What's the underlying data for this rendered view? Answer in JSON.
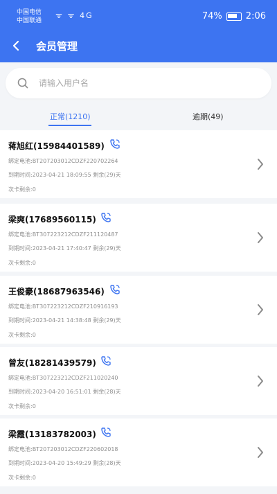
{
  "status_bar": {
    "carrier_top": "中国电信",
    "carrier_bottom": "中国联通",
    "network_icons": "ᯤ ᯤ 4G",
    "battery_percent": "74%",
    "time": "2:06"
  },
  "header": {
    "title": "会员管理"
  },
  "search": {
    "placeholder": "请输入用户名",
    "value": ""
  },
  "tabs": [
    {
      "label": "正常(1210)",
      "active": true
    },
    {
      "label": "逾期(49)",
      "active": false
    }
  ],
  "members": [
    {
      "name_phone": "蒋旭红(15984401589)",
      "battery": "绑定电池:BT207203012CDZF220702264",
      "due": "到期时间:2023-04-21 18:09:55",
      "remaining": "剩余(29)天",
      "times": "次卡剩余:0"
    },
    {
      "name_phone": "梁爽(17689560115)",
      "battery": "绑定电池:BT307223212CDZF211120487",
      "due": "到期时间:2023-04-21 17:40:47",
      "remaining": "剩余(29)天",
      "times": "次卡剩余:0"
    },
    {
      "name_phone": "王俊豪(18687963546)",
      "battery": "绑定电池:BT307223212CDZF210916193",
      "due": "到期时间:2023-04-21 14:38:48",
      "remaining": "剩余(29)天",
      "times": "次卡剩余:0"
    },
    {
      "name_phone": "曾友(18281439579)",
      "battery": "绑定电池:BT307223212CDZF211020240",
      "due": "到期时间:2023-04-20 16:51:01",
      "remaining": "剩余(28)天",
      "times": "次卡剩余:0"
    },
    {
      "name_phone": "梁霞(13183782003)",
      "battery": "绑定电池:BT207203012CDZF220602018",
      "due": "到期时间:2023-04-20 15:49:29",
      "remaining": "剩余(28)天",
      "times": "次卡剩余:0"
    }
  ],
  "colors": {
    "accent": "#3d74f1",
    "background": "#f3f5f8"
  }
}
